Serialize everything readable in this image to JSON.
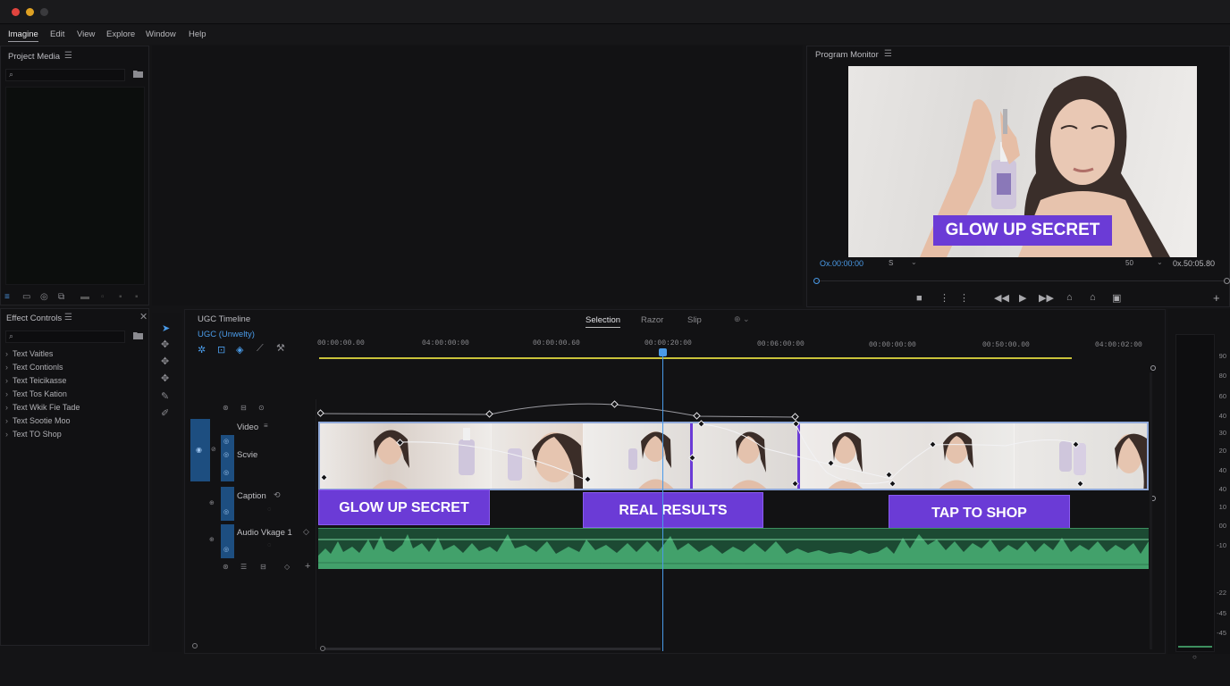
{
  "menu": {
    "items": [
      "Imagine",
      "Edit",
      "View",
      "Explore",
      "Window",
      "Help"
    ]
  },
  "project_panel": {
    "title": "Project Media"
  },
  "effect_controls": {
    "title": "Effect Controls",
    "items": [
      "Text Vaitles",
      "Text Contionls",
      "Text Teicikasse",
      "Text Tos Kation",
      "Text Wkik Fie Tade",
      "Text Sootie Moo",
      "Text TO Shop"
    ]
  },
  "program_monitor": {
    "title": "Program Monitor",
    "overlay_text": "GLOW UP SECRET",
    "timecode_in": "Ox.00:00:00",
    "fit_value": "S",
    "zoom_value": "50",
    "duration": "0x.50:05.80"
  },
  "timeline": {
    "title": "UGC Timeline",
    "sequence_name": "UGC (Unwelty)",
    "modes": [
      "Selection",
      "Razor",
      "Slip"
    ],
    "active_mode": "Selection",
    "ruler_ticks": [
      "00:00:00.00",
      "04:00:00:00",
      "00:00:00.60",
      "00:00:20:00",
      "00:06:00:00",
      "00:00:00:00",
      "00:50:00.00",
      "04:00:02:00"
    ],
    "tracks": {
      "video": "Video",
      "scene": "Scvie",
      "caption": "Caption",
      "audio": "Audio Vkage 1"
    },
    "captions": [
      "GLOW UP SECRET",
      "REAL RESULTS",
      "TAP TO SHOP"
    ]
  },
  "audio_meter": {
    "scale": [
      "90",
      "80",
      "60",
      "40",
      "30",
      "20",
      "40",
      "40",
      "10",
      "00",
      "-10",
      "-22",
      "-45",
      "-45"
    ]
  },
  "colors": {
    "accent": "#6b3bd6",
    "audio": "#3d8f5f",
    "playhead": "#4a9be8",
    "work_area": "#c9c23a"
  }
}
